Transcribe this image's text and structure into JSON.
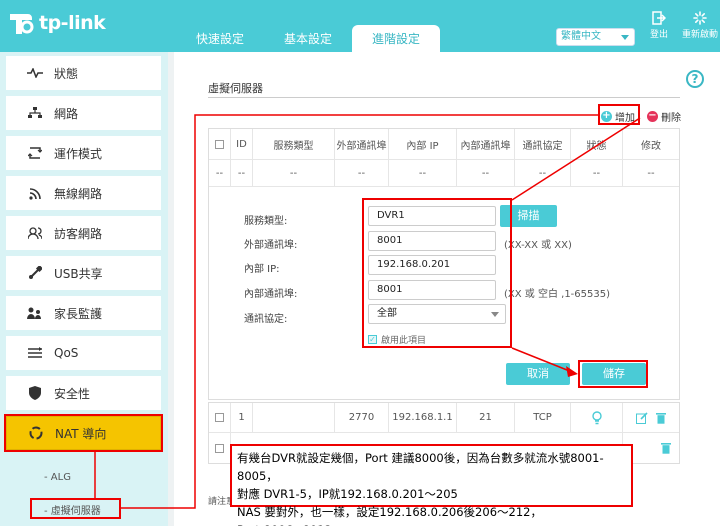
{
  "brand": {
    "name": "tp-link"
  },
  "tabs": [
    {
      "label": "快速設定"
    },
    {
      "label": "基本設定"
    },
    {
      "label": "進階設定"
    }
  ],
  "language": {
    "selected": "繁體中文"
  },
  "header_buttons": {
    "logout": "登出",
    "reboot": "重新啟動"
  },
  "sidebar": {
    "items": [
      {
        "label": "狀態",
        "icon": "pulse-icon"
      },
      {
        "label": "網路",
        "icon": "network-icon"
      },
      {
        "label": "運作模式",
        "icon": "mode-icon"
      },
      {
        "label": "無線網路",
        "icon": "wifi-icon"
      },
      {
        "label": "訪客網路",
        "icon": "guest-icon"
      },
      {
        "label": "USB共享",
        "icon": "usb-icon"
      },
      {
        "label": "家長監護",
        "icon": "parental-icon"
      },
      {
        "label": "QoS",
        "icon": "qos-icon"
      },
      {
        "label": "安全性",
        "icon": "shield-icon"
      },
      {
        "label": "NAT 導向",
        "icon": "nat-icon"
      }
    ],
    "sub_items": [
      {
        "label": "ALG"
      },
      {
        "label": "虛擬伺服器"
      }
    ],
    "active_color": "#f5c400"
  },
  "main": {
    "title": "虛擬伺服器",
    "add_label": "增加",
    "delete_label": "刪除",
    "columns": [
      "ID",
      "服務類型",
      "外部通訊埠",
      "內部 IP",
      "內部通訊埠",
      "通訊協定",
      "狀態",
      "修改"
    ],
    "placeholder_row": [
      "--",
      "--",
      "--",
      "--",
      "--",
      "--",
      "--",
      "--"
    ],
    "form": {
      "service_type_label": "服務類型:",
      "service_type_value": "DVR1",
      "scan_label": "掃描",
      "external_port_label": "外部通訊埠:",
      "external_port_value": "8001",
      "external_port_hint": "(XX-XX 或 XX)",
      "internal_ip_label": "內部 IP:",
      "internal_ip_value": "192.168.0.201",
      "internal_port_label": "內部通訊埠:",
      "internal_port_value": "8001",
      "internal_port_hint": "(XX 或 空白 ,1-65535)",
      "protocol_label": "通訊協定:",
      "protocol_value": "全部",
      "enable_label": "啟用此項目",
      "cancel_label": "取消",
      "save_label": "儲存"
    },
    "rows": [
      {
        "id": "1",
        "ext_port": "2770",
        "ip": "192.168.1.1",
        "int_port": "21",
        "protocol": "TCP"
      }
    ],
    "footnote": "請注意"
  },
  "annotation": {
    "line1": "有幾台DVR就設定幾個，Port 建議8000後，因為台數多就流水號8001-8005，",
    "line2": "對應 DVR1-5，IP就192.168.0.201～205",
    "line3": "NAS 要對外，也一樣，設定192.168.0.206後206～212，Port:8006~8012"
  },
  "colors": {
    "teal": "#4acbd6",
    "accent": "#3ab7c4",
    "red": "#e00000",
    "delete": "#e5335a"
  }
}
